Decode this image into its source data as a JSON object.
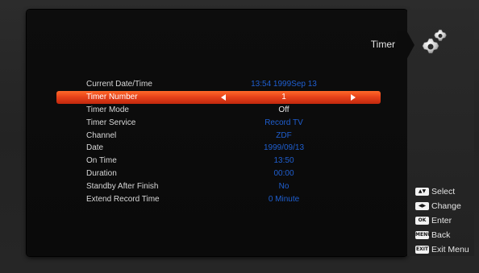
{
  "header": {
    "title": "Timer"
  },
  "menu": {
    "rows": [
      {
        "label": "Current Date/Time",
        "value": "13:54 1999Sep 13"
      },
      {
        "label": "Timer Number",
        "value": "1"
      },
      {
        "label": "Timer Mode",
        "value": "Off"
      },
      {
        "label": "Timer Service",
        "value": "Record TV"
      },
      {
        "label": "Channel",
        "value": "ZDF"
      },
      {
        "label": "Date",
        "value": "1999/09/13"
      },
      {
        "label": "On Time",
        "value": "13:50"
      },
      {
        "label": "Duration",
        "value": "00:00"
      },
      {
        "label": "Standby After Finish",
        "value": "No"
      },
      {
        "label": "Extend Record Time",
        "value": "0 Minute"
      }
    ]
  },
  "help": {
    "items": [
      {
        "key": "▲▼",
        "label": "Select"
      },
      {
        "key": "◀▶",
        "label": "Change"
      },
      {
        "key": "OK",
        "label": "Enter"
      },
      {
        "key": "MENU",
        "label": "Back"
      },
      {
        "key": "EXIT",
        "label": "Exit Menu"
      }
    ]
  },
  "colors": {
    "highlight": "#e8431a",
    "value_blue": "#1f5fd0"
  },
  "icons": {
    "header": "gear-icon"
  }
}
